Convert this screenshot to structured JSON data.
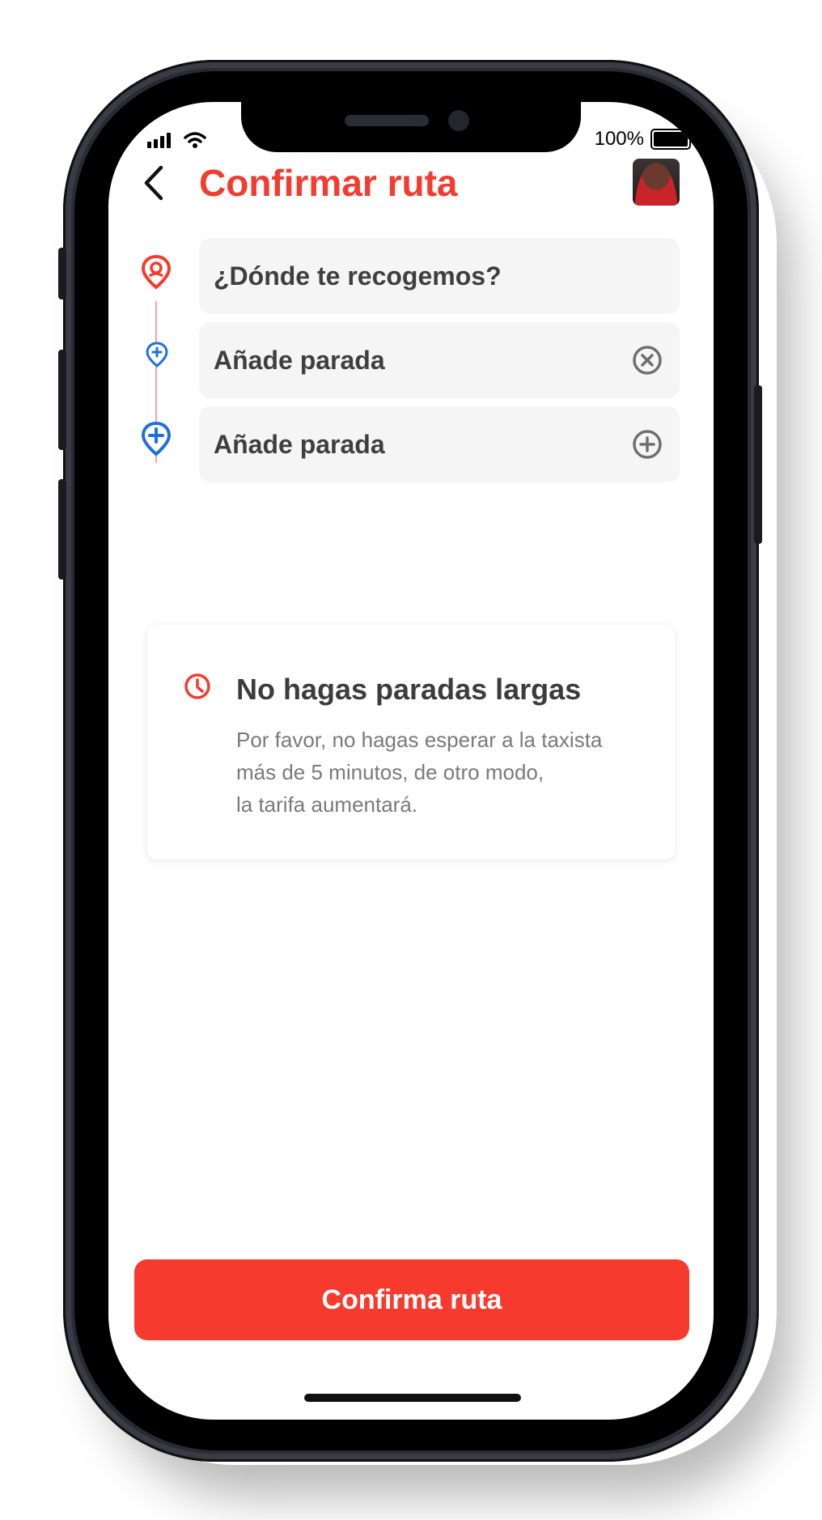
{
  "status_bar": {
    "battery_text": "100%"
  },
  "header": {
    "title": "Confirmar ruta",
    "back_icon": "chevron-left-icon",
    "avatar_icon": "user-avatar"
  },
  "route": {
    "fields": [
      {
        "text": "¿Dónde te recogemos?",
        "pin_icon": "pickup-pin-icon",
        "action_icon": null
      },
      {
        "text": "Añade parada",
        "pin_icon": "stop-add-pin-small-icon",
        "action_icon": "remove-circle-icon"
      },
      {
        "text": "Añade parada",
        "pin_icon": "stop-add-pin-icon",
        "action_icon": "add-circle-icon"
      }
    ]
  },
  "notice": {
    "icon": "clock-icon",
    "title": "No hagas paradas largas",
    "body_lines": [
      "Por favor, no hagas esperar a la taxista",
      "más de 5 minutos, de otro modo,",
      "la tarifa aumentará."
    ]
  },
  "footer": {
    "confirm_label": "Confirma ruta"
  },
  "colors": {
    "accent": "#f43b2f",
    "route_blue": "#1f6fe0",
    "route_line": "#f6a3a0",
    "field_bg": "#f5f5f5"
  }
}
